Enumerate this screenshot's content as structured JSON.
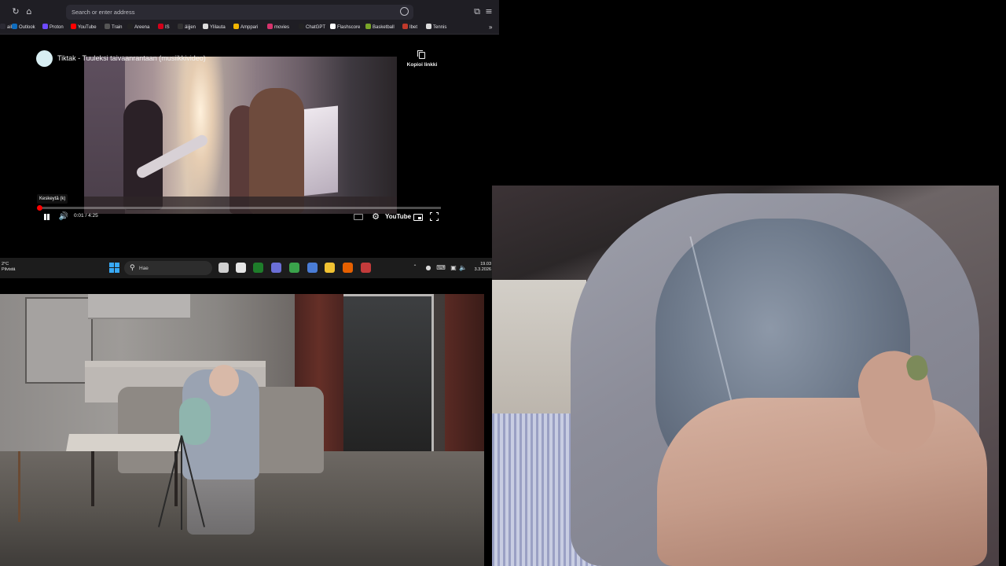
{
  "browser": {
    "url_placeholder": "Search or enter address",
    "bookmarks": [
      {
        "label": "ail",
        "icon": "mail-icon",
        "color": "#2b2a33"
      },
      {
        "label": "Outlook",
        "icon": "outlook-icon",
        "color": "#0f6cbd"
      },
      {
        "label": "Proton",
        "icon": "proton-icon",
        "color": "#6d4aff"
      },
      {
        "label": "YouTube",
        "icon": "youtube-icon",
        "color": "#ff0000"
      },
      {
        "label": "Train",
        "icon": "train-icon",
        "color": "#555555"
      },
      {
        "label": "Areena",
        "icon": "areena-icon",
        "color": "#222222"
      },
      {
        "label": "IS",
        "icon": "is-icon",
        "color": "#d4001a"
      },
      {
        "label": "äijjen",
        "icon": "star-icon",
        "color": "#333333"
      },
      {
        "label": "Ylilauta",
        "icon": "ylilauta-icon",
        "color": "#dddddd"
      },
      {
        "label": "Amppari",
        "icon": "amppari-icon",
        "color": "#f2b600"
      },
      {
        "label": "movies",
        "icon": "heart-icon",
        "color": "#d6336c"
      },
      {
        "label": "ChatGPT",
        "icon": "chatgpt-icon",
        "color": "#222222"
      },
      {
        "label": "Flashscore",
        "icon": "flashscore-icon",
        "color": "#ffffff"
      },
      {
        "label": "Basketball",
        "icon": "basketball-icon",
        "color": "#7aa629"
      },
      {
        "label": "Ibet",
        "icon": "ibet-icon",
        "color": "#c0392b"
      },
      {
        "label": "Tennis",
        "icon": "tennis-icon",
        "color": "#dddddd"
      }
    ]
  },
  "video": {
    "title": "Tiktak - Tuuleksi taivaanrantaan (musiikkivideo)",
    "copy_link_label": "Kopioi linkki",
    "tooltip": "Keskeytä (k)",
    "time": "0:01 / 4:25",
    "progress_fraction": 0.004,
    "youtube_label": "YouTube"
  },
  "taskbar": {
    "temperature": "2°C",
    "weather": "Pilvistä",
    "search_placeholder": "Hae",
    "time": "19.03",
    "date": "3.3.2026",
    "apps": [
      {
        "name": "task-view-icon",
        "color": "#cfcfcf"
      },
      {
        "name": "chatgpt-app-icon",
        "color": "#e6e6e6"
      },
      {
        "name": "xbox-app-icon",
        "color": "#1e7d2a"
      },
      {
        "name": "obs-app-icon",
        "color": "#6b6fd6"
      },
      {
        "name": "calc-app-icon",
        "color": "#3aa34b"
      },
      {
        "name": "notepad-app-icon",
        "color": "#4a7dd6"
      },
      {
        "name": "file-explorer-icon",
        "color": "#f1c232"
      },
      {
        "name": "firefox-app-icon",
        "color": "#e66000"
      },
      {
        "name": "game-app-icon",
        "color": "#c33b3b"
      }
    ]
  }
}
